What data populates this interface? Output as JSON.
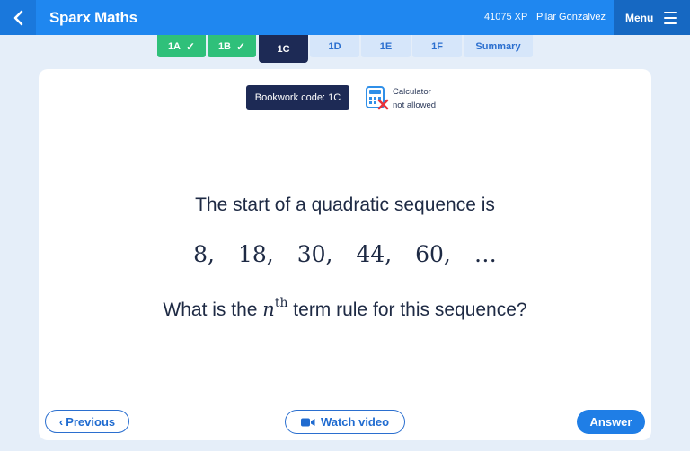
{
  "topbar": {
    "brand": "Sparx Maths",
    "xp": "41075 XP",
    "user": "Pilar Gonzalvez",
    "menu_label": "Menu"
  },
  "tabs": [
    {
      "label": "1A",
      "state": "done"
    },
    {
      "label": "1B",
      "state": "done"
    },
    {
      "label": "1C",
      "state": "active"
    },
    {
      "label": "1D",
      "state": "todo"
    },
    {
      "label": "1E",
      "state": "todo"
    },
    {
      "label": "1F",
      "state": "todo"
    },
    {
      "label": "Summary",
      "state": "todo"
    }
  ],
  "card": {
    "bookwork": "Bookwork code: 1C",
    "calculator_line1": "Calculator",
    "calculator_line2": "not allowed",
    "question_intro": "The start of a quadratic sequence is",
    "sequence": [
      "8,",
      "18,",
      "30,",
      "44,",
      "60,",
      "…"
    ],
    "question_pre": "What is the ",
    "question_n": "n",
    "question_sup": "th",
    "question_post": " term rule for this sequence?"
  },
  "footer": {
    "previous_label": "Previous",
    "watch_label": "Watch video",
    "answer_label": "Answer"
  },
  "colors": {
    "topbar": "#1f87f0",
    "done_tab": "#2fc07a",
    "active_tab": "#1d2a55",
    "accent": "#1f7ee6"
  }
}
